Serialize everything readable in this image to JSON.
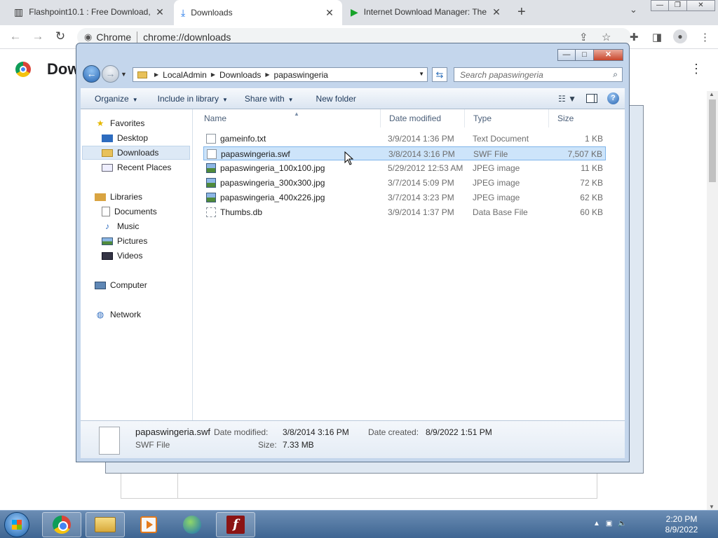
{
  "browser": {
    "tabs": [
      {
        "title": "Flashpoint10.1 : Free Download,",
        "icon": "archive-icon"
      },
      {
        "title": "Downloads",
        "icon": "download-icon"
      },
      {
        "title": "Internet Download Manager: The",
        "icon": "idm-icon"
      }
    ],
    "tab_close": "✕",
    "new_tab": "+",
    "omnibox_label": "Chrome",
    "omnibox_url": "chrome://downloads",
    "page_title": "Downloads"
  },
  "explorer": {
    "breadcrumb": [
      "LocalAdmin",
      "Downloads",
      "papaswingeria"
    ],
    "search_placeholder": "Search papaswingeria",
    "commands": {
      "organize": "Organize",
      "include": "Include in library",
      "share": "Share with",
      "new_folder": "New folder"
    },
    "nav": {
      "favorites": "Favorites",
      "desktop": "Desktop",
      "downloads": "Downloads",
      "recent": "Recent Places",
      "libraries": "Libraries",
      "documents": "Documents",
      "music": "Music",
      "pictures": "Pictures",
      "videos": "Videos",
      "computer": "Computer",
      "network": "Network"
    },
    "columns": {
      "name": "Name",
      "date": "Date modified",
      "type": "Type",
      "size": "Size"
    },
    "files": [
      {
        "name": "gameinfo.txt",
        "date": "3/9/2014 1:36 PM",
        "type": "Text Document",
        "size": "1 KB"
      },
      {
        "name": "papaswingeria.swf",
        "date": "3/8/2014 3:16 PM",
        "type": "SWF File",
        "size": "7,507 KB"
      },
      {
        "name": "papaswingeria_100x100.jpg",
        "date": "5/29/2012 12:53 AM",
        "type": "JPEG image",
        "size": "11 KB"
      },
      {
        "name": "papaswingeria_300x300.jpg",
        "date": "3/7/2014 5:09 PM",
        "type": "JPEG image",
        "size": "72 KB"
      },
      {
        "name": "papaswingeria_400x226.jpg",
        "date": "3/7/2014 3:23 PM",
        "type": "JPEG image",
        "size": "62 KB"
      },
      {
        "name": "Thumbs.db",
        "date": "3/9/2014 1:37 PM",
        "type": "Data Base File",
        "size": "60 KB"
      }
    ],
    "details": {
      "name": "papaswingeria.swf",
      "type": "SWF File",
      "modified_label": "Date modified:",
      "modified": "3/8/2014 3:16 PM",
      "created_label": "Date created:",
      "created": "8/9/2022 1:51 PM",
      "size_label": "Size:",
      "size": "7.33 MB"
    }
  },
  "taskbar": {
    "time": "2:20 PM",
    "date": "8/9/2022"
  }
}
